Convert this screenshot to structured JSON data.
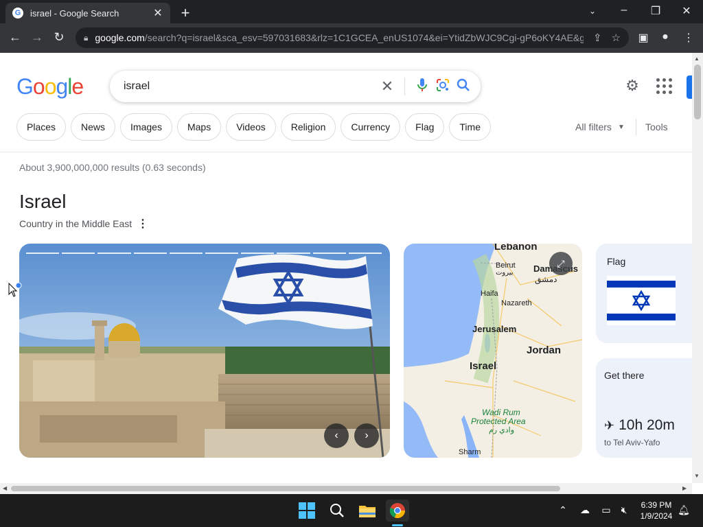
{
  "browser": {
    "tab_title": "israel - Google Search",
    "tab_favicon": "G",
    "url_host": "google.com",
    "url_rest": "/search?q=israel&sca_esv=597031683&rlz=1C1GCEA_enUS1074&ei=YtidZbWJC9Cgi-gP6oKY4AE&g..."
  },
  "search": {
    "logo": "Google",
    "query": "israel",
    "colors": {
      "blue": "#4285f4",
      "red": "#ea4335",
      "yellow": "#fbbc05",
      "green": "#34a853"
    }
  },
  "chips": [
    "Places",
    "News",
    "Images",
    "Maps",
    "Videos",
    "Religion",
    "Currency",
    "Flag",
    "Time"
  ],
  "filters": {
    "all_filters": "All filters",
    "tools": "Tools"
  },
  "results": {
    "stats": "About 3,900,000,000 results (0.63 seconds)"
  },
  "knowledge_panel": {
    "title": "Israel",
    "subtitle": "Country in the Middle East",
    "carousel_segments": 10,
    "map_labels": {
      "lebanon": "Lebanon",
      "beirut": "Beirut",
      "beirut_ar": "بيروت",
      "damascus": "Damascus",
      "damascus_ar": "دمشق",
      "haifa": "Haifa",
      "nazareth": "Nazareth",
      "jerusalem": "Jerusalem",
      "jordan": "Jordan",
      "israel": "Israel",
      "wadi_rum": "Wadi Rum",
      "protected_area": "Protected Area",
      "wadi_rum_ar": "وادي رم",
      "sharm": "Sharm"
    },
    "flag_card": {
      "label": "Flag"
    },
    "get_there": {
      "label": "Get there",
      "duration": "10h 20m",
      "destination": "to Tel Aviv-Yafo"
    }
  },
  "taskbar": {
    "time": "6:39 PM",
    "date": "1/9/2024"
  }
}
